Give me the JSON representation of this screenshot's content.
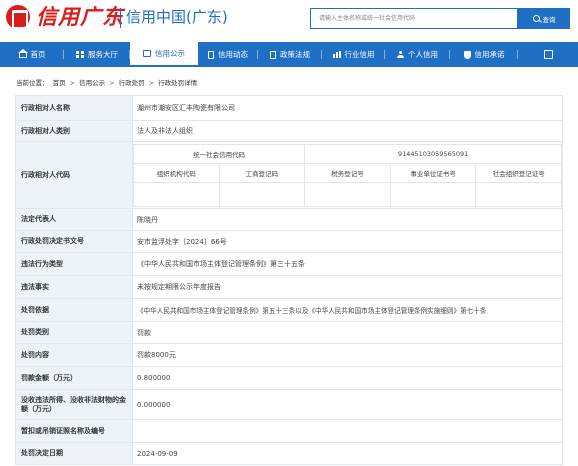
{
  "header": {
    "logo_script": "信用广东",
    "logo_text": "信用中国(广东)",
    "search_placeholder": "请输入主体名称或统一社会信用代码",
    "search_button": "查询"
  },
  "nav": [
    {
      "label": "首页",
      "icon": "home-icon"
    },
    {
      "label": "服务大厅",
      "icon": "grid-icon"
    },
    {
      "label": "信用公示",
      "icon": "notice-box-icon",
      "active": true
    },
    {
      "label": "信用动态",
      "icon": "news-icon"
    },
    {
      "label": "政策法规",
      "icon": "document-icon"
    },
    {
      "label": "行业信用",
      "icon": "bar-chart-icon"
    },
    {
      "label": "个人信用",
      "icon": "user-icon"
    },
    {
      "label": "信用承诺",
      "icon": "shield-icon"
    },
    {
      "label": "",
      "icon": "expand-icon"
    }
  ],
  "breadcrumb": {
    "prefix": "当前位置：",
    "items": [
      "首页",
      "信用公示",
      "行政处罚",
      "行政处罚详情"
    ]
  },
  "details": {
    "party_name_label": "行政相对人名称",
    "party_name": "潮州市潮安区汇丰陶瓷有限公司",
    "party_type_label": "行政相对人类别",
    "party_type": "法人及非法人组织",
    "party_code_label": "行政相对人代码",
    "uscc_label": "统一社会信用代码",
    "uscc": "91445103059565091",
    "code_headers": [
      "组织机构代码",
      "工商登记码",
      "税务登记号",
      "事业单位证书号",
      "社会组织登记证号"
    ],
    "code_values": [
      "",
      "",
      "",
      "",
      ""
    ],
    "legal_rep_label": "法定代表人",
    "legal_rep": "陈晓丹",
    "decision_no_label": "行政处罚决定书文号",
    "decision_no": "安市监浮处字〔2024〕66号",
    "violation_type_label": "违法行为类型",
    "violation_type": "《中华人民共和国市场主体登记管理条例》第三十五条",
    "facts_label": "违法事实",
    "facts": "未按规定期限公示年度报告",
    "basis_label": "处罚依据",
    "basis": "《中华人民共和国市场主体登记管理条例》第五十三条以及《中华人民共和国市场主体登记管理条例实施细则》第七十条",
    "category_label": "处罚类别",
    "category": "罚款",
    "content_label": "处罚内容",
    "content": "罚款8000元",
    "fine_label": "罚款金额（万元）",
    "fine": "0.800000",
    "confiscated_label": "没收违法所得、没收非法财物的金额（万元）",
    "confiscated": "0.000000",
    "license_label": "暂扣或吊销证照名称及编号",
    "license": "",
    "date_label": "处罚决定日期",
    "date": "2024-09-09"
  },
  "colors": {
    "brand_blue": "#1f6fc5",
    "logo_red": "#d81e1e",
    "label_bg": "#eef3fa"
  }
}
